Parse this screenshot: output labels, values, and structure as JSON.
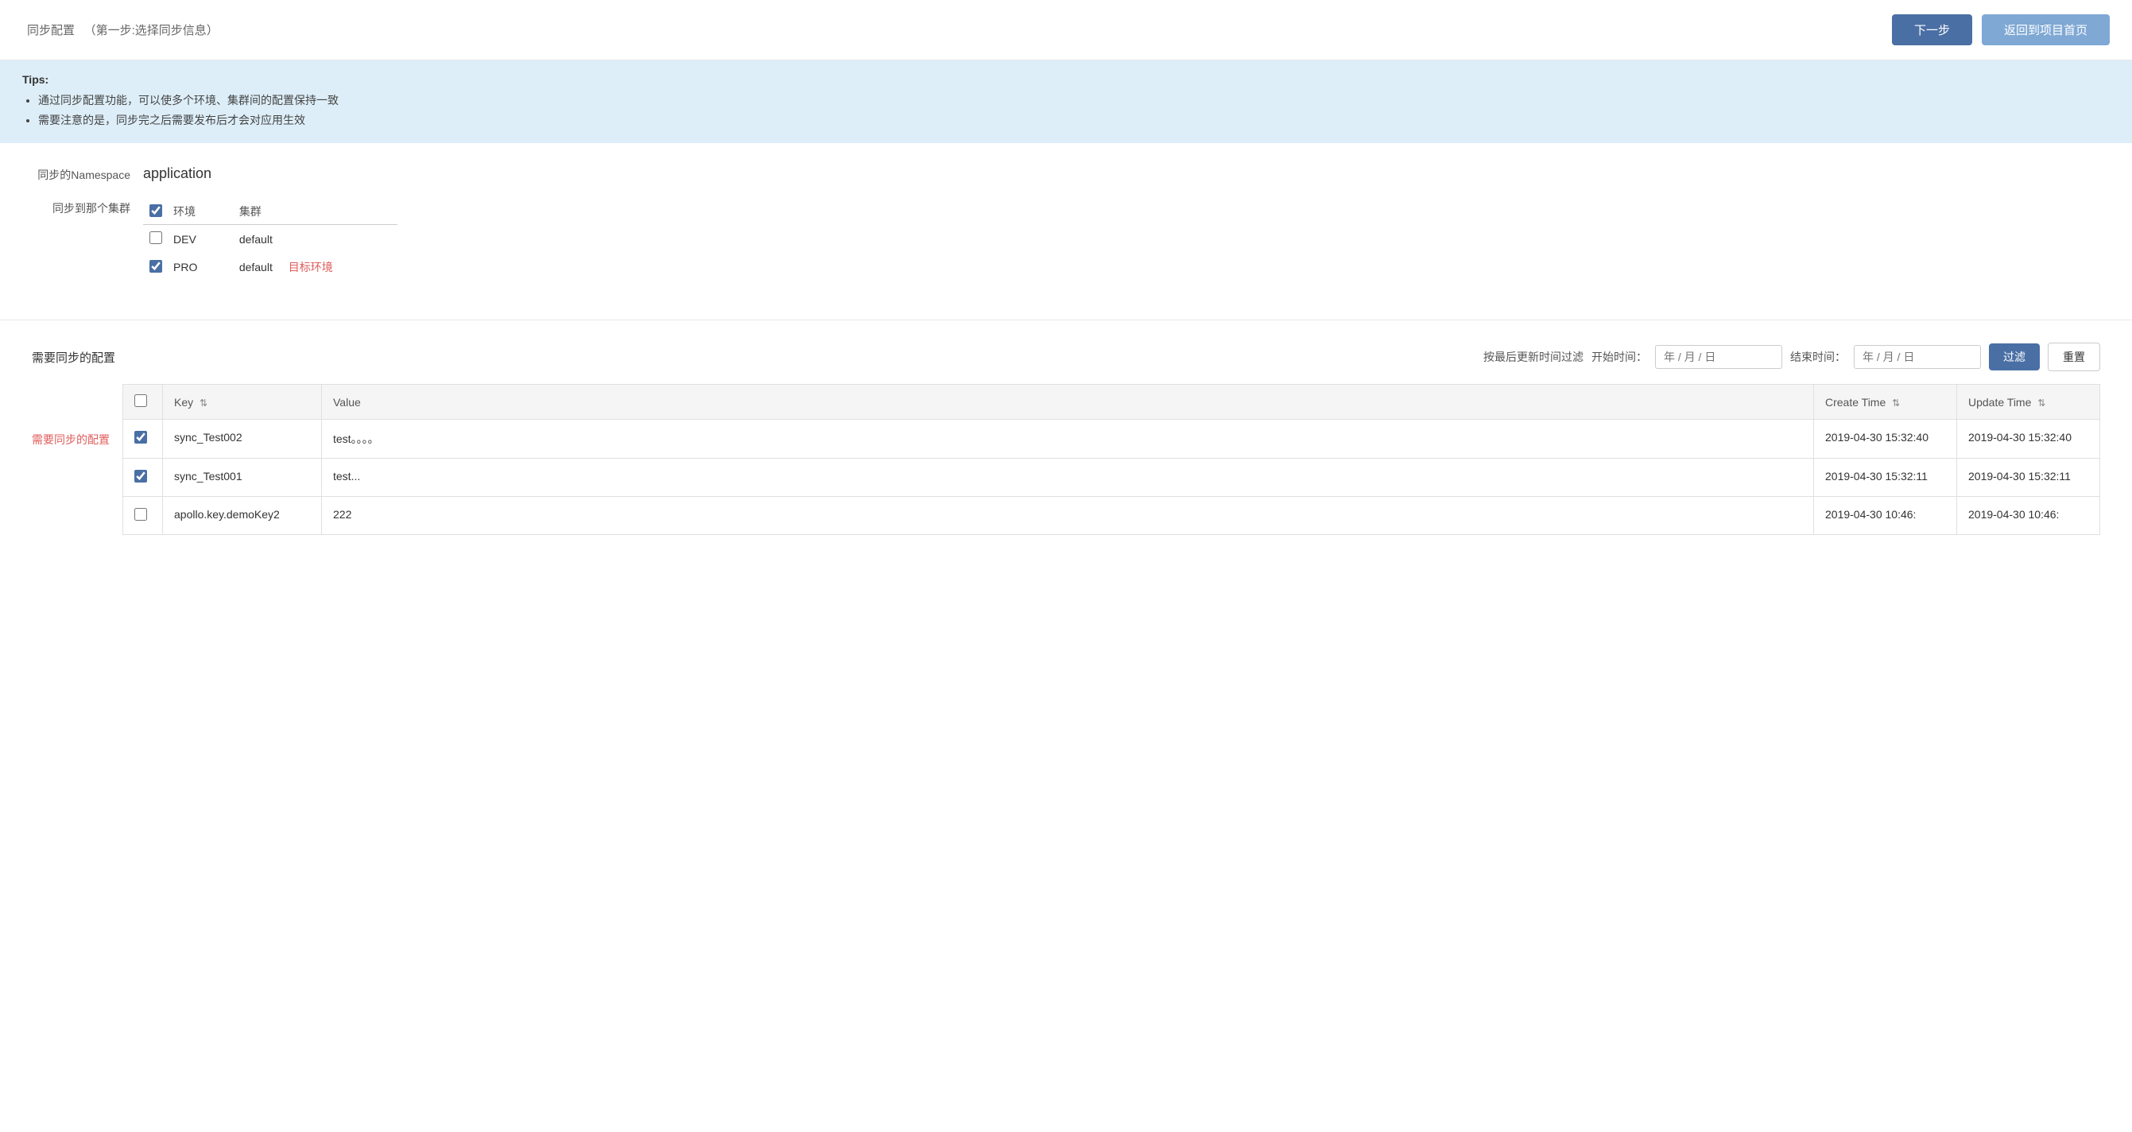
{
  "header": {
    "title": "同步配置",
    "subtitle": "（第一步:选择同步信息）",
    "next_button": "下一步",
    "back_button": "返回到项目首页"
  },
  "tips": {
    "title": "Tips:",
    "items": [
      "通过同步配置功能，可以使多个环境、集群间的配置保持一致",
      "需要注意的是，同步完之后需要发布后才会对应用生效"
    ]
  },
  "sync_namespace": {
    "label": "同步的Namespace",
    "value": "application"
  },
  "sync_cluster": {
    "label": "同步到那个集群",
    "table": {
      "headers": [
        "",
        "环境",
        "集群"
      ],
      "rows": [
        {
          "checked": false,
          "env": "DEV",
          "cluster": "default",
          "target_label": ""
        },
        {
          "checked": true,
          "env": "PRO",
          "cluster": "default",
          "target_label": "目标环境"
        }
      ]
    }
  },
  "config_section": {
    "title": "需要同步的配置",
    "side_label": "需要同步的配置",
    "filter": {
      "label": "按最后更新时间过滤",
      "start_label": "开始时间：",
      "start_placeholder": "年 / 月 / 日",
      "end_label": "结束时间：",
      "end_placeholder": "年 / 月 / 日",
      "filter_button": "过滤",
      "reset_button": "重置"
    },
    "table": {
      "headers": [
        "",
        "Key",
        "Value",
        "Create Time",
        "Update Time"
      ],
      "rows": [
        {
          "checked": true,
          "key": "sync_Test002",
          "value": "test。。。。",
          "create_time": "2019-04-30 15:32:40",
          "update_time": "2019-04-30 15:32:40"
        },
        {
          "checked": true,
          "key": "sync_Test001",
          "value": "test...",
          "create_time": "2019-04-30 15:32:11",
          "update_time": "2019-04-30 15:32:11"
        },
        {
          "checked": false,
          "key": "apollo.key.demoKey2",
          "value": "222",
          "create_time": "2019-04-30 10:46:",
          "update_time": "2019-04-30 10:46:"
        }
      ]
    }
  }
}
